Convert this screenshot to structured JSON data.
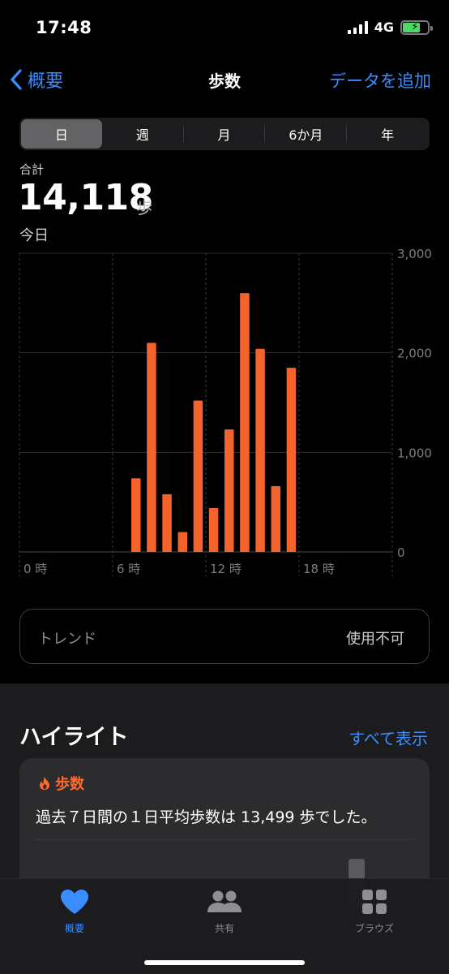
{
  "status_bar": {
    "time": "17:48",
    "network": "4G"
  },
  "nav": {
    "back_label": "概要",
    "title": "歩数",
    "action_label": "データを追加"
  },
  "segments": [
    {
      "label": "日",
      "active": true
    },
    {
      "label": "週",
      "active": false
    },
    {
      "label": "月",
      "active": false
    },
    {
      "label": "6か月",
      "active": false
    },
    {
      "label": "年",
      "active": false
    }
  ],
  "summary": {
    "total_label": "合計",
    "total_value": "14,118",
    "unit": "歩",
    "date_label": "今日"
  },
  "chart_data": {
    "type": "bar",
    "x_ticks": [
      "0 時",
      "6 時",
      "12 時",
      "18 時"
    ],
    "y_ticks": [
      "3,000",
      "2,000",
      "1,000",
      "0"
    ],
    "ylim": [
      0,
      3000
    ],
    "xlim": [
      0,
      24
    ],
    "color": "#f4632b",
    "bars": [
      {
        "hour": 7,
        "value": 740
      },
      {
        "hour": 8,
        "value": 2100
      },
      {
        "hour": 9,
        "value": 580
      },
      {
        "hour": 10,
        "value": 200
      },
      {
        "hour": 11,
        "value": 1520
      },
      {
        "hour": 12,
        "value": 440
      },
      {
        "hour": 13,
        "value": 1230
      },
      {
        "hour": 14,
        "value": 2600
      },
      {
        "hour": 15,
        "value": 2040
      },
      {
        "hour": 16,
        "value": 660
      },
      {
        "hour": 17,
        "value": 1850
      }
    ]
  },
  "trend": {
    "label": "トレンド",
    "value": "使用不可"
  },
  "highlights": {
    "title": "ハイライト",
    "show_all": "すべて表示",
    "card": {
      "category": "歩数",
      "text": "過去７日間の１日平均歩数は 13,499 歩でした。"
    }
  },
  "tabs": [
    {
      "label": "概要",
      "icon": "heart-icon",
      "active": true
    },
    {
      "label": "共有",
      "icon": "people-icon",
      "active": false
    },
    {
      "label": "ブラウズ",
      "icon": "grid-icon",
      "active": false
    }
  ],
  "colors": {
    "accent": "#3a8dff",
    "bar": "#f4632b",
    "highlight": "#ff6a2c"
  }
}
